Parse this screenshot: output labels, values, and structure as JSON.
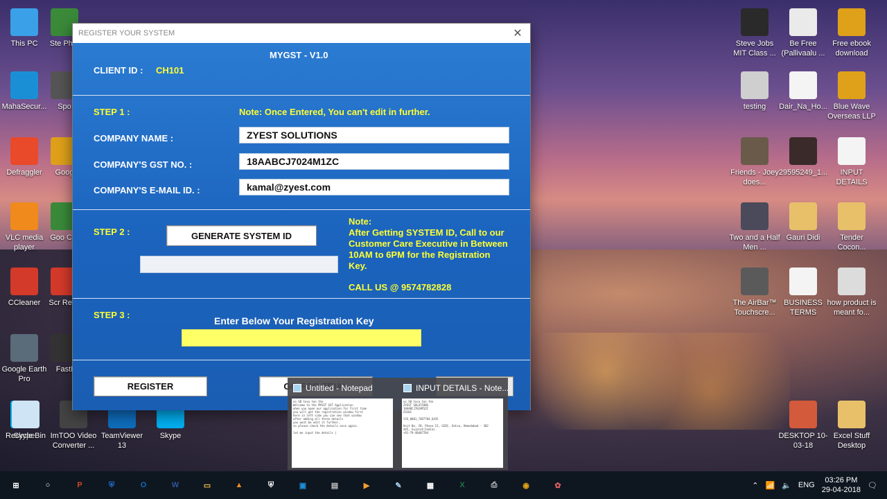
{
  "desktop": {
    "left_icons": [
      {
        "label": "This PC",
        "icon": "pc-icon",
        "color": "#3aa0e8"
      },
      {
        "label": "MahaSecur...",
        "icon": "lock-icon",
        "color": "#1b8fd6"
      },
      {
        "label": "Defraggler",
        "icon": "defraggler-icon",
        "color": "#e84a2a"
      },
      {
        "label": "VLC media player",
        "icon": "vlc-icon",
        "color": "#f08a1c"
      },
      {
        "label": "CCleaner",
        "icon": "ccleaner-icon",
        "color": "#d43a2a"
      },
      {
        "label": "Google Earth Pro",
        "icon": "earth-icon",
        "color": "#5a6b7a"
      },
      {
        "label": "Skype",
        "icon": "skype-icon",
        "color": "#00aff0"
      }
    ],
    "partial_icons": [
      {
        "label": "Ste Phot",
        "icon": "photo-icon",
        "color": "#3a8a3a"
      },
      {
        "label": "Spo",
        "icon": "app-icon",
        "color": "#555"
      },
      {
        "label": "Goog",
        "icon": "chrome-icon",
        "color": "#dfa11a"
      },
      {
        "label": "Goo Chr",
        "icon": "chrome-icon",
        "color": "#3a8a3a"
      },
      {
        "label": "Scr Reco",
        "icon": "record-icon",
        "color": "#d43a2a"
      },
      {
        "label": "FastI",
        "icon": "app-icon",
        "color": "#333"
      }
    ],
    "bottom_icons": [
      {
        "label": "ImTOO Video Converter ...",
        "icon": "film-icon",
        "color": "#444"
      },
      {
        "label": "TeamViewer 13",
        "icon": "teamviewer-icon",
        "color": "#0e6ebd"
      },
      {
        "label": "Skype",
        "icon": "skype-icon",
        "color": "#00aff0"
      }
    ],
    "right_icons": [
      {
        "label": "Steve Jobs MIT Class ...",
        "icon": "video-icon",
        "color": "#2a2a2a"
      },
      {
        "label": "Be Free (Pallivaalu ...",
        "icon": "mp3-icon",
        "color": "#eaeaea"
      },
      {
        "label": "Free ebook download",
        "icon": "chrome-icon",
        "color": "#dfa11a"
      },
      {
        "label": "testing",
        "icon": "image-icon",
        "color": "#cfcfcf"
      },
      {
        "label": "Dair_Na_Ho...",
        "icon": "image-icon",
        "color": "#f4f4f4"
      },
      {
        "label": "Blue Wave Overseas LLP",
        "icon": "chrome-icon",
        "color": "#dfa11a"
      },
      {
        "label": "Friends - Joey does...",
        "icon": "video-icon",
        "color": "#6a5a4a"
      },
      {
        "label": "29595249_1...",
        "icon": "image-icon",
        "color": "#3a2a2a"
      },
      {
        "label": "INPUT DETAILS",
        "icon": "text-file-icon",
        "color": "#f4f4f4"
      },
      {
        "label": "Two and a Half Men ...",
        "icon": "video-icon",
        "color": "#4a4a5a"
      },
      {
        "label": "Gauri Didi",
        "icon": "folder-icon",
        "color": "#e8c06a"
      },
      {
        "label": "Tender Cocon...",
        "icon": "folder-icon",
        "color": "#e8c06a"
      },
      {
        "label": "The AirBar™ Touchscre...",
        "icon": "video-icon",
        "color": "#5a5a5a"
      },
      {
        "label": "BUSINESS TERMS",
        "icon": "text-file-icon",
        "color": "#f4f4f4"
      },
      {
        "label": "how product is meant fo...",
        "icon": "video-icon",
        "color": "#dcdcdc"
      },
      {
        "label": "DESKTOP 10-03-18",
        "icon": "folder-icon",
        "color": "#d35a3a"
      },
      {
        "label": "Excel Stuff Desktop",
        "icon": "folder-icon",
        "color": "#e8c06a"
      },
      {
        "label": "Recycle Bin",
        "icon": "recycle-bin-icon",
        "color": "#cfe4f5"
      }
    ]
  },
  "dialog": {
    "title": "REGISTER YOUR SYSTEM",
    "app_name": "MYGST - V1.0",
    "client_id_label": "CLIENT ID :",
    "client_id": "CH101",
    "step1": {
      "label": "STEP 1 :",
      "note": "Note: Once Entered, You can't edit in further.",
      "company_name_label": "COMPANY NAME :",
      "company_name": "ZYEST SOLUTIONS",
      "gst_label": "COMPANY'S GST NO. :",
      "gst": "18AABCJ7024M1ZC",
      "email_label": "COMPANY'S E-MAIL ID. :",
      "email": "kamal@zyest.com"
    },
    "step2": {
      "label": "STEP 2 :",
      "generate_button": "GENERATE SYSTEM ID",
      "system_id": "",
      "note_title": "Note:",
      "note_body": "After Getting SYSTEM ID, Call to our Customer Care Executive in Between 10AM to 6PM for the Registration Key.",
      "call": "CALL US @ 9574782828"
    },
    "step3": {
      "label": "STEP 3 :",
      "instruction": "Enter Below Your Registration Key",
      "key": ""
    },
    "register_button": "REGISTER",
    "trial_button": "GO FOR TRIAL",
    "colors": {
      "form_bg": "#2370c8",
      "yellow": "#ffff33",
      "key_field": "#ffff66"
    }
  },
  "thumbnails": [
    {
      "title": "Untitled - Notepad",
      "lines": [
        "no SB tosa teo the",
        "Welcome to the MYGST GST Application",
        "when you open our application for first time",
        "you will get the registration window first",
        "here in left side you can see that window",
        "after adding all three details",
        "you wont be edit it further,",
        "so please check the details once again.",
        "",
        "let me input the details |"
      ]
    },
    {
      "title": "INPUT DETAILS - Note...",
      "lines": [
        "no SB tosa teo the",
        "ZYEST SOLUTIONS",
        "18AABCJ7024M1ZC",
        "CH101",
        "",
        "YJS_0001_74D7784_6435",
        "",
        "Unit No. 28, Phase II, GIDC, Vatva, Ahmedabad - 382",
        "445, Gujarat(India).",
        "+91-79-40407704"
      ]
    }
  ],
  "taskbar": {
    "apps": [
      {
        "name": "start-icon",
        "glyph": "⊞",
        "color": "#ffffff"
      },
      {
        "name": "search-icon",
        "glyph": "○",
        "color": "#ffffff"
      },
      {
        "name": "powerpoint-icon",
        "glyph": "P",
        "color": "#d24726"
      },
      {
        "name": "shield-app-icon",
        "glyph": "⛨",
        "color": "#1f6fd0"
      },
      {
        "name": "outlook-icon",
        "glyph": "O",
        "color": "#0f6cbd"
      },
      {
        "name": "word-icon",
        "glyph": "W",
        "color": "#2b579a"
      },
      {
        "name": "file-explorer-icon",
        "glyph": "▭",
        "color": "#f3c24a"
      },
      {
        "name": "vlc-icon",
        "glyph": "▲",
        "color": "#f08a1c"
      },
      {
        "name": "security-icon",
        "glyph": "⛨",
        "color": "#ffffff"
      },
      {
        "name": "remote-desktop-icon",
        "glyph": "▣",
        "color": "#1f8fd6"
      },
      {
        "name": "media-icon",
        "glyph": "▤",
        "color": "#c0c0c0"
      },
      {
        "name": "player-icon",
        "glyph": "▶",
        "color": "#f0a030"
      },
      {
        "name": "notepad-icon",
        "glyph": "✎",
        "color": "#a8d4f0"
      },
      {
        "name": "calculator-icon",
        "glyph": "▦",
        "color": "#ffffff"
      },
      {
        "name": "excel-icon",
        "glyph": "X",
        "color": "#217346"
      },
      {
        "name": "printer-icon",
        "glyph": "⎙",
        "color": "#d0d0d0"
      },
      {
        "name": "chrome-icon",
        "glyph": "◉",
        "color": "#dfa11a"
      },
      {
        "name": "paint-icon",
        "glyph": "✿",
        "color": "#e06060"
      }
    ],
    "language": "ENG",
    "time": "03:26 PM",
    "date": "29-04-2018"
  }
}
